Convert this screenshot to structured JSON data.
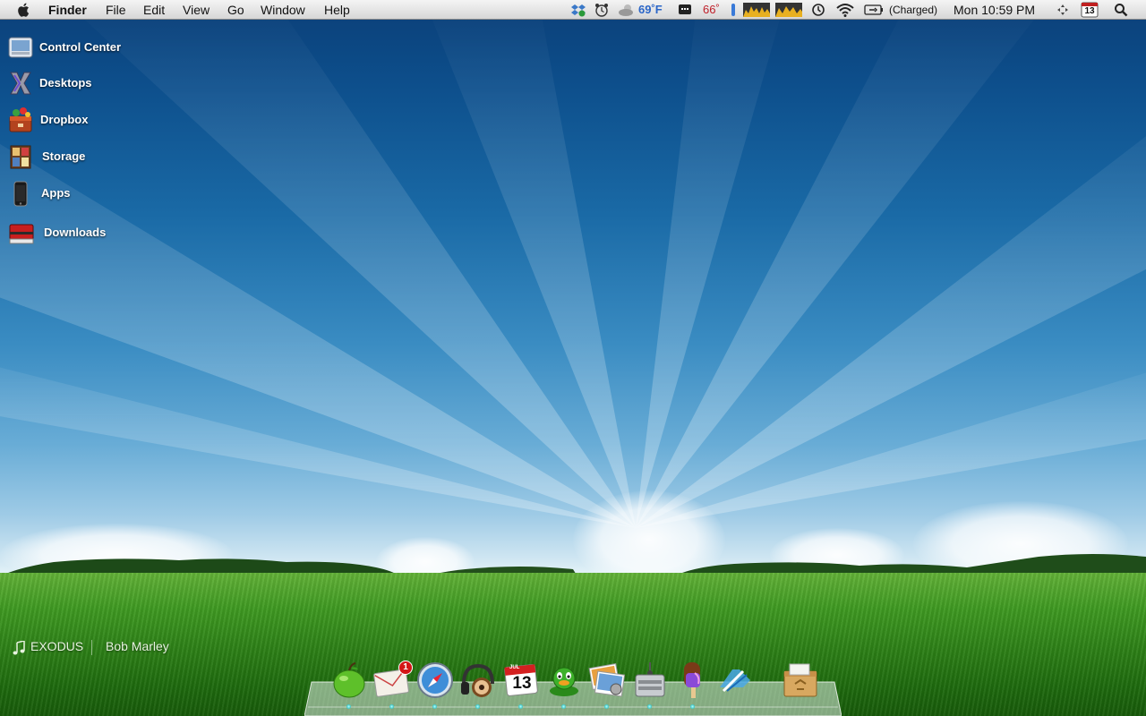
{
  "menubar": {
    "app_name": "Finder",
    "menus": [
      "File",
      "Edit",
      "View",
      "Go",
      "Window",
      "Help"
    ],
    "status": {
      "weather_temp": "69˚F",
      "cpu_temp": "66˚",
      "battery_status": "(Charged)",
      "clock": "Mon 10:59 PM",
      "calendar_day": "13"
    },
    "icons": [
      "dropbox-status-icon",
      "alarm-clock-icon",
      "weather-icon",
      "monitor-icon",
      "thermometer-icon",
      "cpu-graph-icon",
      "memory-graph-icon",
      "time-machine-icon",
      "wifi-icon",
      "battery-icon",
      "spaces-icon",
      "calendar-icon",
      "spotlight-icon"
    ]
  },
  "desktop": {
    "items": [
      {
        "label": "Control Center",
        "icon": "control-center-icon"
      },
      {
        "label": "Desktops",
        "icon": "desktops-x-icon"
      },
      {
        "label": "Dropbox",
        "icon": "dropbox-box-icon"
      },
      {
        "label": "Storage",
        "icon": "storage-cabinet-icon"
      },
      {
        "label": "Apps",
        "icon": "iphone-apps-icon"
      },
      {
        "label": "Downloads",
        "icon": "downloads-book-icon"
      }
    ]
  },
  "now_playing": {
    "track": "EXODUS",
    "artist": "Bob Marley"
  },
  "dock": {
    "items": [
      {
        "name": "finder-apple",
        "icon": "green-apple-icon"
      },
      {
        "name": "mail",
        "icon": "mail-envelope-icon",
        "badge": "1"
      },
      {
        "name": "safari",
        "icon": "safari-compass-icon"
      },
      {
        "name": "itunes",
        "icon": "itunes-headphones-icon"
      },
      {
        "name": "ical",
        "icon": "ical-calendar-icon",
        "date": "13",
        "month": "JUL"
      },
      {
        "name": "adium",
        "icon": "adium-duck-icon"
      },
      {
        "name": "iphoto",
        "icon": "iphoto-photos-icon"
      },
      {
        "name": "hard-drive",
        "icon": "hard-drive-icon"
      },
      {
        "name": "popsicle-app",
        "icon": "popsicle-icon"
      },
      {
        "name": "xcode",
        "icon": "xcode-hammer-icon"
      },
      {
        "name": "trash",
        "icon": "recycle-box-icon"
      }
    ]
  },
  "colors": {
    "sky_top": "#0b3f78",
    "sky_horizon": "#e2f1f7",
    "grass": "#3f9a22",
    "weather_blue": "#2b66c8",
    "cpu_red": "#c0202a"
  }
}
